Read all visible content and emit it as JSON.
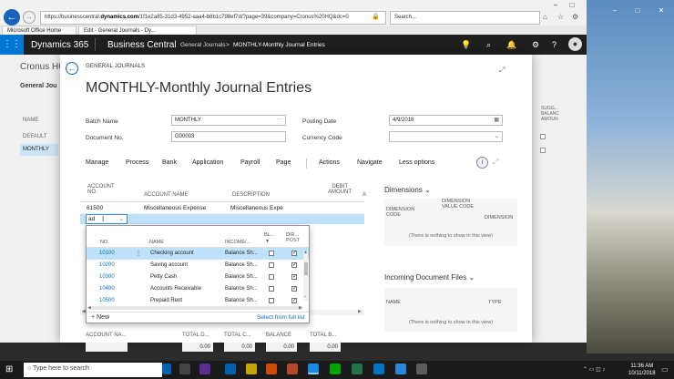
{
  "browser": {
    "url_prefix": "https://businesscentral.",
    "url_domain": "dynamics.com",
    "url_rest": "/1f1e2a85-31d3-4952-aaa4-b8b1c798ef7d/?page=39&company=Cronus%20HQ&dc=0",
    "search_placeholder": "Search...",
    "tabs": [
      "Microsoft Office Home",
      "Edit - General Journals - Dy..."
    ]
  },
  "appbar": {
    "product": "Dynamics 365",
    "app": "Business Central",
    "crumb1": "General Journals",
    "crumb_sep": ">",
    "crumb2": "MONTHLY-Monthly Journal Entries"
  },
  "background": {
    "title": "Cronus HC",
    "subtitle": "General Jou",
    "name_col": "NAME",
    "default": "DEFAULT",
    "monthly": "MONTHLY",
    "sugg": "SUGG... BALANC AMOUN"
  },
  "modal": {
    "breadcrumb": "GENERAL JOURNALS",
    "title": "MONTHLY-Monthly Journal Entries",
    "fields": {
      "batch_name_label": "Batch Name",
      "batch_name": "MONTHLY",
      "document_no_label": "Document No.",
      "document_no": "G00003",
      "posting_date_label": "Posting Date",
      "posting_date": "4/9/2018",
      "currency_code_label": "Currency Code",
      "currency_code": ""
    },
    "actions": [
      "Manage",
      "Process",
      "Bank",
      "Application",
      "Payroll",
      "Page",
      "Actions",
      "Navigate",
      "Less options"
    ],
    "grid": {
      "headers": {
        "account_no": "ACCOUNT NO.",
        "account_name": "ACCOUNT NAME",
        "description": "DESCRIPTION",
        "debit": "DEBIT AMOUNT",
        "credit_cut": "A"
      },
      "rows": [
        {
          "account_no": "61500",
          "account_name": "Miscellaneous Expense",
          "description": "Miscellaneous Expe"
        }
      ],
      "editing_value": "ad"
    },
    "lookup": {
      "headers": {
        "no": "NO.",
        "name": "NAME",
        "income": "INCOME/...",
        "bl": "BL...",
        "dir": "DIR... POST"
      },
      "rows": [
        {
          "no": "10100",
          "name": "Checking account",
          "income": "Balance Sh...",
          "bl": false,
          "dir": true
        },
        {
          "no": "10200",
          "name": "Saving account",
          "income": "Balance Sh...",
          "bl": false,
          "dir": true
        },
        {
          "no": "10300",
          "name": "Petty Cash",
          "income": "Balance Sh...",
          "bl": false,
          "dir": true
        },
        {
          "no": "10400",
          "name": "Accounts Receivable",
          "income": "Balance Sh...",
          "bl": false,
          "dir": true
        },
        {
          "no": "10500",
          "name": "Prepaid Rent",
          "income": "Balance Sh...",
          "bl": false,
          "dir": true
        }
      ],
      "new_label": "New",
      "full_list_label": "Select from full list"
    },
    "factbox": {
      "dimensions_title": "Dimensions",
      "dim_col1": "DIMENSION CODE",
      "dim_col2": "DIMENSION VALUE CODE",
      "dim_col3": "DIMENSION",
      "empty1": "(There is nothing to show in this view)",
      "incoming_title": "Incoming Document Files",
      "inc_col1": "NAME",
      "inc_col2": "TYPE",
      "empty2": "(There is nothing to show in this view)"
    },
    "totals": {
      "account_name_label": "ACCOUNT NA...",
      "total_debit_label": "TOTAL D...",
      "total_debit": "0.00",
      "total_credit_label": "TOTAL C...",
      "total_credit": "0.00",
      "balance_label": "BALANCE",
      "balance": "0.00",
      "total_balance_label": "TOTAL B...",
      "total_balance": "0.00"
    }
  },
  "taskbar": {
    "search_placeholder": "Type here to search",
    "time": "11:36 AM",
    "date": "10/11/2018"
  },
  "colors": {
    "accent": "#0a6ebd",
    "selection": "#bfe2fb",
    "appbar": "#1f1f1f"
  }
}
